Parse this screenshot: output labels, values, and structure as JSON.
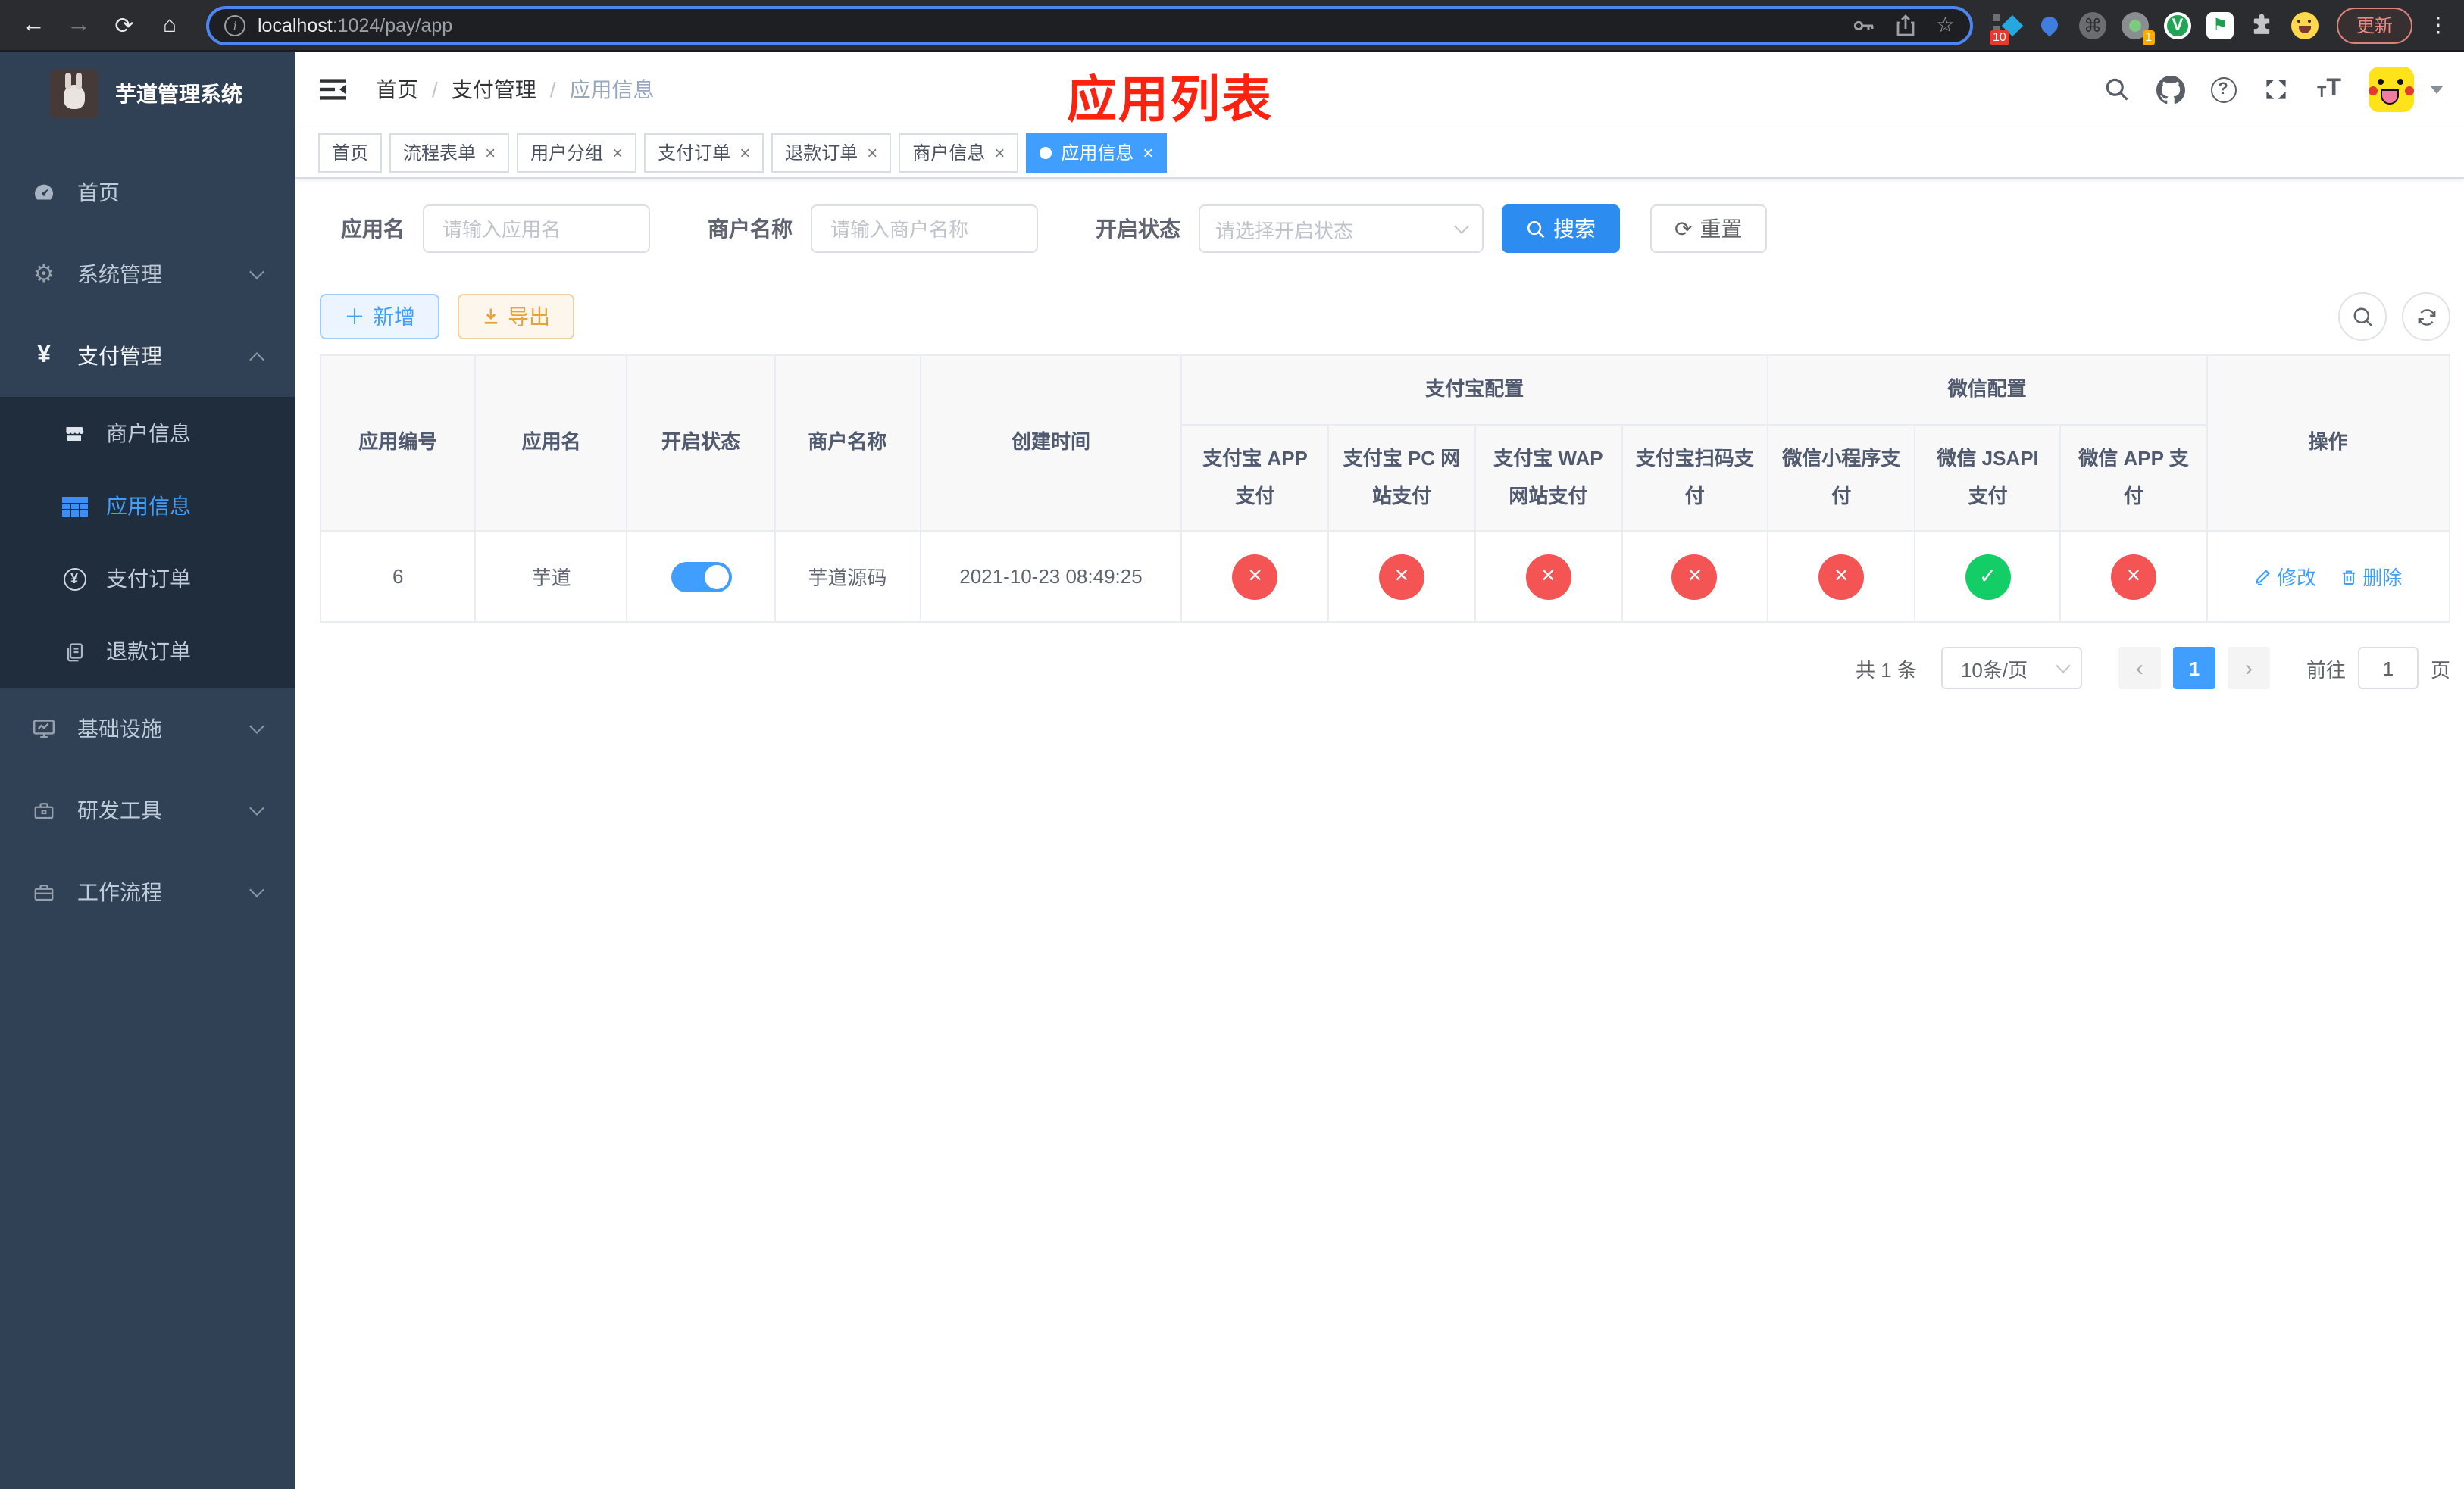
{
  "browser": {
    "url": {
      "host": "localhost",
      "path": ":1024/pay/app"
    },
    "extensions": {
      "diamond_badge": "10",
      "ring_badge": "1"
    },
    "update_label": "更新"
  },
  "sidebar": {
    "title": "芋道管理系统",
    "items": [
      {
        "label": "首页",
        "icon": "dashboard"
      },
      {
        "label": "系统管理",
        "icon": "gear",
        "chevron": "down"
      },
      {
        "label": "支付管理",
        "icon": "yen",
        "chevron": "up",
        "expanded": true,
        "children": [
          {
            "label": "商户信息",
            "icon": "shop"
          },
          {
            "label": "应用信息",
            "icon": "grid-table",
            "active": true
          },
          {
            "label": "支付订单",
            "icon": "yen-circle"
          },
          {
            "label": "退款订单",
            "icon": "document"
          }
        ]
      },
      {
        "label": "基础设施",
        "icon": "monitor",
        "chevron": "down"
      },
      {
        "label": "研发工具",
        "icon": "toolbox",
        "chevron": "down"
      },
      {
        "label": "工作流程",
        "icon": "briefcase",
        "chevron": "down"
      }
    ]
  },
  "header": {
    "breadcrumb": {
      "items": [
        "首页",
        "支付管理",
        "应用信息"
      ],
      "separator": "/"
    },
    "overlay_title": "应用列表"
  },
  "tabs": {
    "items": [
      {
        "label": "首页",
        "closable": false,
        "active": false
      },
      {
        "label": "流程表单",
        "closable": true,
        "active": false
      },
      {
        "label": "用户分组",
        "closable": true,
        "active": false
      },
      {
        "label": "支付订单",
        "closable": true,
        "active": false
      },
      {
        "label": "退款订单",
        "closable": true,
        "active": false
      },
      {
        "label": "商户信息",
        "closable": true,
        "active": false
      },
      {
        "label": "应用信息",
        "closable": true,
        "active": true
      }
    ]
  },
  "main": {
    "filters": {
      "app_name": {
        "label": "应用名",
        "placeholder": "请输入应用名"
      },
      "merchant_name": {
        "label": "商户名称",
        "placeholder": "请输入商户名称"
      },
      "status": {
        "label": "开启状态",
        "placeholder": "请选择开启状态"
      },
      "search_label": "搜索",
      "reset_label": "重置"
    },
    "toolbar": {
      "add_label": "新增",
      "export_label": "导出"
    },
    "table": {
      "group_headers": [
        {
          "label": "支付宝配置",
          "colspan": 4
        },
        {
          "label": "微信配置",
          "colspan": 3
        }
      ],
      "columns": [
        "应用编号",
        "应用名",
        "开启状态",
        "商户名称",
        "创建时间",
        "支付宝 APP 支付",
        "支付宝 PC 网站支付",
        "支付宝 WAP 网站支付",
        "支付宝扫码支付",
        "微信小程序支付",
        "微信 JSAPI 支付",
        "微信 APP 支付",
        "操作"
      ],
      "rows": [
        {
          "app_id": "6",
          "app_name": "芋道",
          "enabled": true,
          "merchant": "芋道源码",
          "created_at": "2021-10-23 08:49:25",
          "pay_configs": [
            {
              "name": "alipay-app-pay",
              "enabled": false
            },
            {
              "name": "alipay-pc-pay",
              "enabled": false
            },
            {
              "name": "alipay-wap-pay",
              "enabled": false
            },
            {
              "name": "alipay-qrcode-pay",
              "enabled": false
            },
            {
              "name": "wechat-miniprogram-pay",
              "enabled": false
            },
            {
              "name": "wechat-jsapi-pay",
              "enabled": true
            },
            {
              "name": "wechat-app-pay",
              "enabled": false
            }
          ],
          "edit_label": "修改",
          "delete_label": "删除"
        }
      ]
    },
    "pagination": {
      "total": "共 1 条",
      "page_size": "10条/页",
      "current_page": "1",
      "goto_label": "前往",
      "goto_value": "1",
      "unit_label": "页"
    }
  },
  "colors": {
    "primary": "#409eff",
    "success": "#13ce66",
    "danger": "#f45454",
    "warning": "#e6a23c",
    "sidebar_bg": "#304156",
    "submenu_bg": "#1f2d3d",
    "overlay_title_red": "#fb2210"
  }
}
